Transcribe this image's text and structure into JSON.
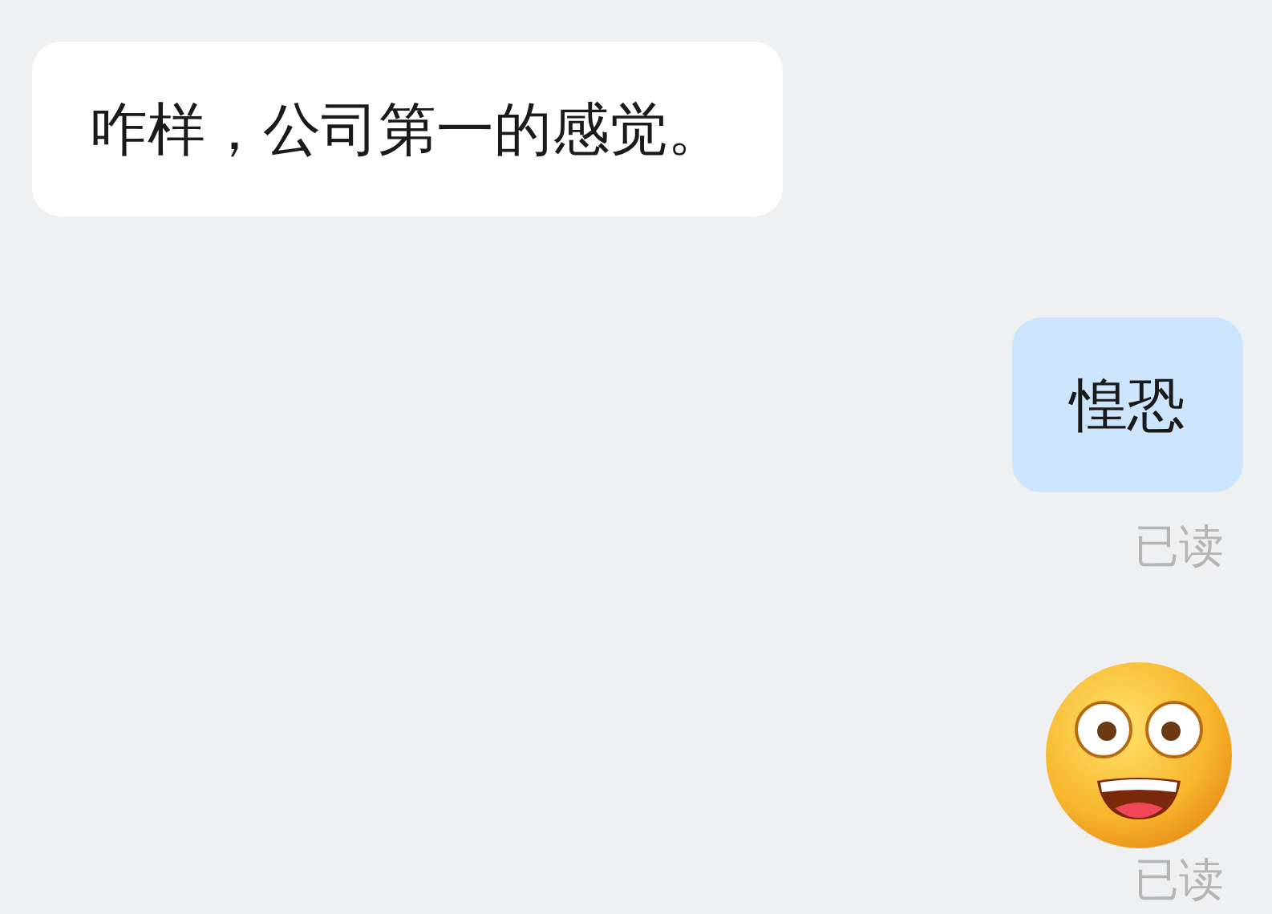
{
  "messages": [
    {
      "kind": "text",
      "outgoing": false,
      "text": "咋样，公司第一的感觉。"
    },
    {
      "kind": "text",
      "outgoing": true,
      "text": "惶恐",
      "receipt": "已读"
    },
    {
      "kind": "emoji",
      "outgoing": true,
      "receipt": "已读"
    }
  ]
}
